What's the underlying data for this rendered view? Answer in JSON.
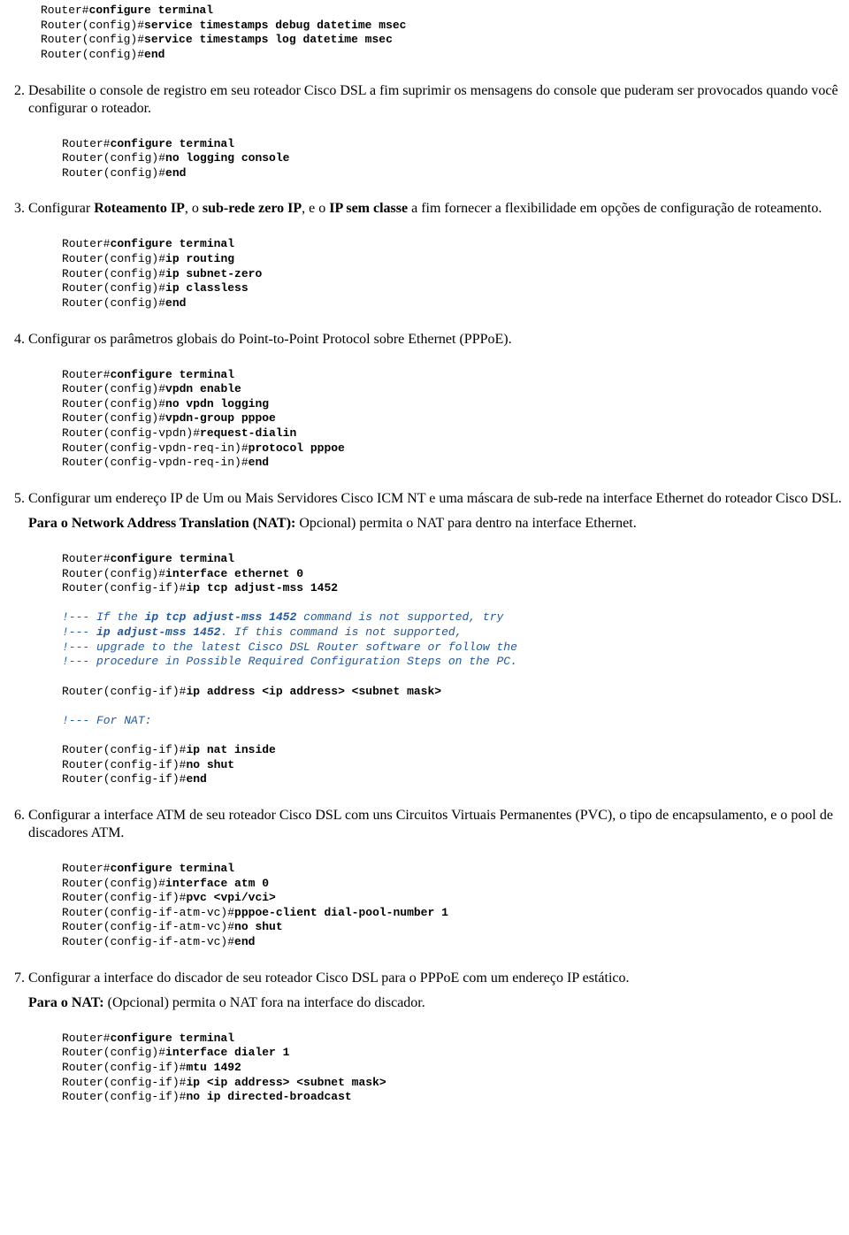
{
  "code1": {
    "l1p": "Router#",
    "l1c": "configure terminal",
    "l2p": "Router(config)#",
    "l2c": "service timestamps debug datetime msec",
    "l3p": "Router(config)#",
    "l3c": "service timestamps log datetime msec",
    "l4p": "Router(config)#",
    "l4c": "end"
  },
  "step2": {
    "text": "Desabilite o console de registro em seu roteador Cisco DSL a fim suprimir os mensagens do console que puderam ser provocados quando você configurar o roteador.",
    "code": {
      "l1p": "Router#",
      "l1c": "configure terminal",
      "l2p": "Router(config)#",
      "l2c": "no logging console",
      "l3p": "Router(config)#",
      "l3c": "end"
    }
  },
  "step3": {
    "t1": "Configurar ",
    "b1": "Roteamento IP",
    "t2": ", o ",
    "b2": "sub-rede zero IP",
    "t3": ", e o ",
    "b3": "IP sem classe",
    "t4": " a fim fornecer a flexibilidade em opções de configuração de roteamento.",
    "code": {
      "l1p": "Router#",
      "l1c": "configure terminal",
      "l2p": "Router(config)#",
      "l2c": "ip routing",
      "l3p": "Router(config)#",
      "l3c": "ip subnet-zero",
      "l4p": "Router(config)#",
      "l4c": "ip classless",
      "l5p": "Router(config)#",
      "l5c": "end"
    }
  },
  "step4": {
    "text": "Configurar os parâmetros globais do Point-to-Point Protocol sobre Ethernet (PPPoE).",
    "code": {
      "l1p": "Router#",
      "l1c": "configure terminal",
      "l2p": "Router(config)#",
      "l2c": "vpdn enable",
      "l3p": "Router(config)#",
      "l3c": "no vpdn logging",
      "l4p": "Router(config)#",
      "l4c": "vpdn-group pppoe",
      "l5p": "Router(config-vpdn)#",
      "l5c": "request-dialin",
      "l6p": "Router(config-vpdn-req-in)#",
      "l6c": "protocol pppoe",
      "l7p": "Router(config-vpdn-req-in)#",
      "l7c": "end"
    }
  },
  "step5": {
    "p1": "Configurar um endereço IP de Um ou Mais Servidores Cisco ICM NT e uma máscara de sub-rede na interface Ethernet do roteador Cisco DSL.",
    "p2b": "Para o Network Address Translation (NAT):",
    "p2t": " Opcional) permita o NAT para dentro na interface Ethernet.",
    "code": {
      "l1p": "Router#",
      "l1c": "configure terminal",
      "l2p": "Router(config)#",
      "l2c": "interface ethernet 0",
      "l3p": "Router(config-if)#",
      "l3c": "ip tcp adjust-mss 1452",
      "c1a": "!--- If the ",
      "c1b": "ip tcp adjust-mss 1452",
      "c1c": " command is not supported, try",
      "c2a": "!--- ",
      "c2b": "ip adjust-mss 1452",
      "c2c": ". If this command is not supported,",
      "c3": "!--- upgrade to the latest Cisco DSL Router software or follow the",
      "c4": "!--- procedure in Possible Required Configuration Steps on the PC.",
      "l4p": "Router(config-if)#",
      "l4c": "ip address <ip address> <subnet mask>",
      "c5": "!--- For NAT:",
      "l5p": "Router(config-if)#",
      "l5c": "ip nat inside",
      "l6p": "Router(config-if)#",
      "l6c": "no shut",
      "l7p": "Router(config-if)#",
      "l7c": "end"
    }
  },
  "step6": {
    "text": "Configurar a interface ATM de seu roteador Cisco DSL com uns Circuitos Virtuais Permanentes (PVC), o tipo de encapsulamento, e o pool de discadores ATM.",
    "code": {
      "l1p": "Router#",
      "l1c": "configure terminal",
      "l2p": "Router(config)#",
      "l2c": "interface atm 0",
      "l3p": "Router(config-if)#",
      "l3c": "pvc <vpi/vci>",
      "l4p": "Router(config-if-atm-vc)#",
      "l4c": "pppoe-client dial-pool-number 1",
      "l5p": "Router(config-if-atm-vc)#",
      "l5c": "no shut",
      "l6p": "Router(config-if-atm-vc)#",
      "l6c": "end"
    }
  },
  "step7": {
    "p1": "Configurar a interface do discador de seu roteador Cisco DSL para o PPPoE com um endereço IP estático.",
    "p2b": "Para o NAT:",
    "p2t": " (Opcional) permita o NAT fora na interface do discador.",
    "code": {
      "l1p": "Router#",
      "l1c": "configure terminal",
      "l2p": "Router(config)#",
      "l2c": "interface dialer 1",
      "l3p": "Router(config-if)#",
      "l3c": "mtu 1492",
      "l4p": "Router(config-if)#",
      "l4c": "ip <ip address> <subnet mask>",
      "l5p": "Router(config-if)#",
      "l5c": "no ip directed-broadcast"
    }
  }
}
